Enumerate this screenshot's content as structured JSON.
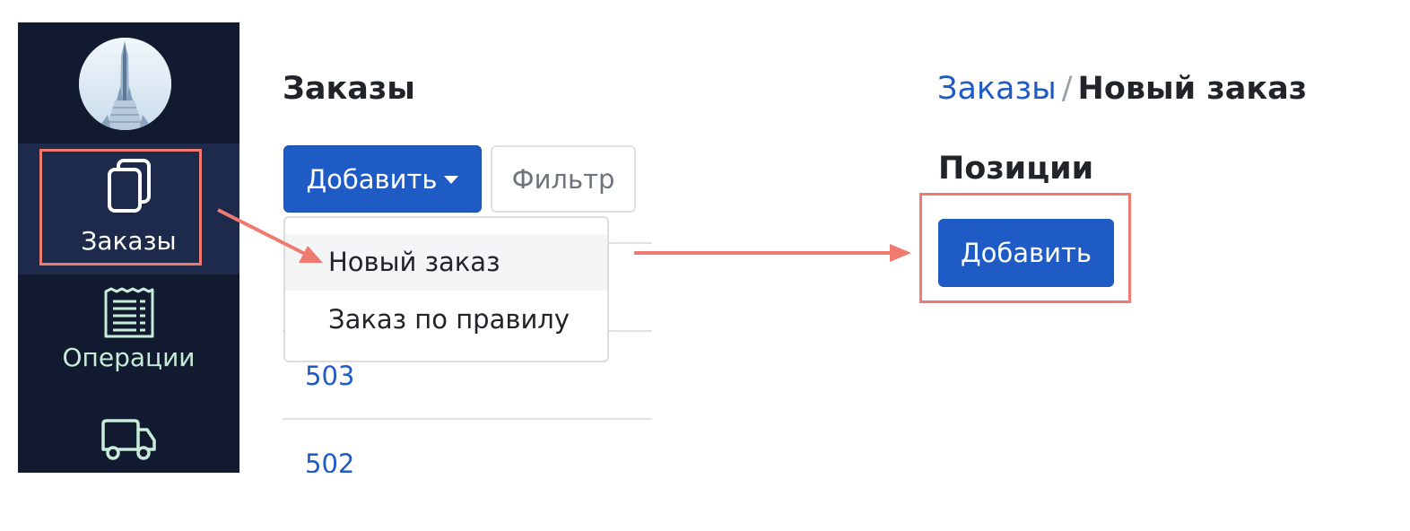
{
  "sidebar": {
    "items": [
      {
        "label": "Заказы",
        "icon": "documents-icon",
        "active": true
      },
      {
        "label": "Операции",
        "icon": "receipt-icon",
        "active": false
      },
      {
        "label": "",
        "icon": "truck-icon",
        "active": false
      }
    ]
  },
  "orders_page": {
    "title": "Заказы",
    "add_button": "Добавить",
    "filter_button": "Фильтр",
    "dropdown": [
      "Новый заказ",
      "Заказ по правилу"
    ],
    "orders": [
      "503",
      "502"
    ]
  },
  "new_order_page": {
    "breadcrumb_parent": "Заказы",
    "breadcrumb_separator": "/",
    "breadcrumb_current": "Новый заказ",
    "section_title": "Позиции",
    "add_button": "Добавить"
  },
  "colors": {
    "sidebar_bg": "#111a2e",
    "sidebar_active_bg": "#1d2a4c",
    "primary": "#1f5bc5",
    "highlight": "#ef7b70"
  }
}
